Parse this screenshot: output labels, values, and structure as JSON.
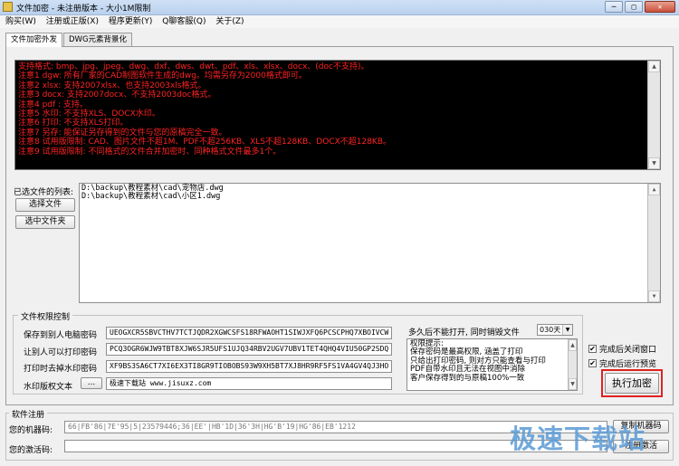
{
  "window": {
    "title": "文件加密 - 未注册版本 - 大小1M限制",
    "buttons": {
      "min": "─",
      "max": "□",
      "close": "✕"
    }
  },
  "menu": [
    "购买(W)",
    "注册或正版(X)",
    "程序更新(Y)",
    "Q聊客服(Q)",
    "关于(Z)"
  ],
  "tabs": [
    "文件加密外发",
    "DWG元素背景化"
  ],
  "console_lines": [
    "支持格式: bmp、jpg、jpeg、dwg、dxf、dws、dwt、pdf、xls、xlsx、docx、(doc不支持)。",
    "注意1 dgw: 所有厂家的CAD制图软件生成的dwg。均需另存为2000格式即可。",
    "注意2 xlsx: 支持2007xlsx、也支持2003xls格式。",
    "注意3 docx: 支持2007docx、不支持2003doc格式。",
    "注意4 pdf : 支持。",
    "注意5 水印: 不支持XLS、DOCX水印。",
    "注意6 打印: 不支持XLS打印。",
    "注意7 另存: 能保证另存得到的文件与您的原稿完全一致。",
    "注意8 试用版限制: CAD、图片文件不超1M、PDF不超256KB、XLS不超128KB、DOCX不超128KB。",
    "注意9 试用版限制: 不同格式的文件合并加密时、同种格式文件最多1个。"
  ],
  "file_section": {
    "label": "已选文件的列表:",
    "select_file_button": "选择文件",
    "select_folder_button": "选中文件夹",
    "files": [
      "D:\\backup\\教程素材\\cad\\宠物店.dwg",
      "D:\\backup\\教程素材\\cad\\小区1.dwg"
    ]
  },
  "permissions": {
    "title": "文件权限控制",
    "rows": [
      {
        "label": "保存到别人电脑密码",
        "value": "UEOGXCR5SBVCTHV7TCTJQDR2XGWCSFS18RFWAOHT1SIWJXFQ6PCSCPHQ7XBOIVCW"
      },
      {
        "label": "让别人可以打印密码",
        "value": "PCQ3OGR6WJW9TBT8XJW6SJR5UFS1UJQ34RBV2UGV7UBV1TET4QHQ4VIU50GP2SDQ"
      },
      {
        "label": "打印时去掉水印密码",
        "value": "XF9BS3SA6CT7XI6EX3TI8GR9TIOBOBS93W9XH5BT7XJ8HR9RF5FS1VA4GV4QJ3HO"
      },
      {
        "label": "水印版权文本",
        "value": "极速下载站 www.jisuxz.com"
      }
    ],
    "watermark_btn": "...",
    "days_label": "多久后不能打开, 同时销毁文件",
    "days_value": "030天",
    "tips": [
      "权限提示:",
      "保存密码是最高权限, 涵盖了打印",
      "只给出打印密码, 则对方只能查看与打印",
      "PDF自带水印且无法在视图中消除",
      "客户保存得到的与原稿100%一致"
    ]
  },
  "options": {
    "close_after": "完成后关闭窗口",
    "preview_after": "完成后运行预览",
    "check_mark": "✔",
    "execute_button": "执行加密"
  },
  "registration": {
    "title": "软件注册",
    "machine_label": "您的机器码:",
    "machine_code": "66|FB'86|7E'95|5|23579446;36|EE'|HB'1D|36'3H|HG'B'19|HG'86|EB'1212",
    "activation_label": "您的激活码:",
    "activation_code": "",
    "copy_button": "复制机器码",
    "activate_button": "注册激活"
  },
  "watermark_text": "极速下载站"
}
